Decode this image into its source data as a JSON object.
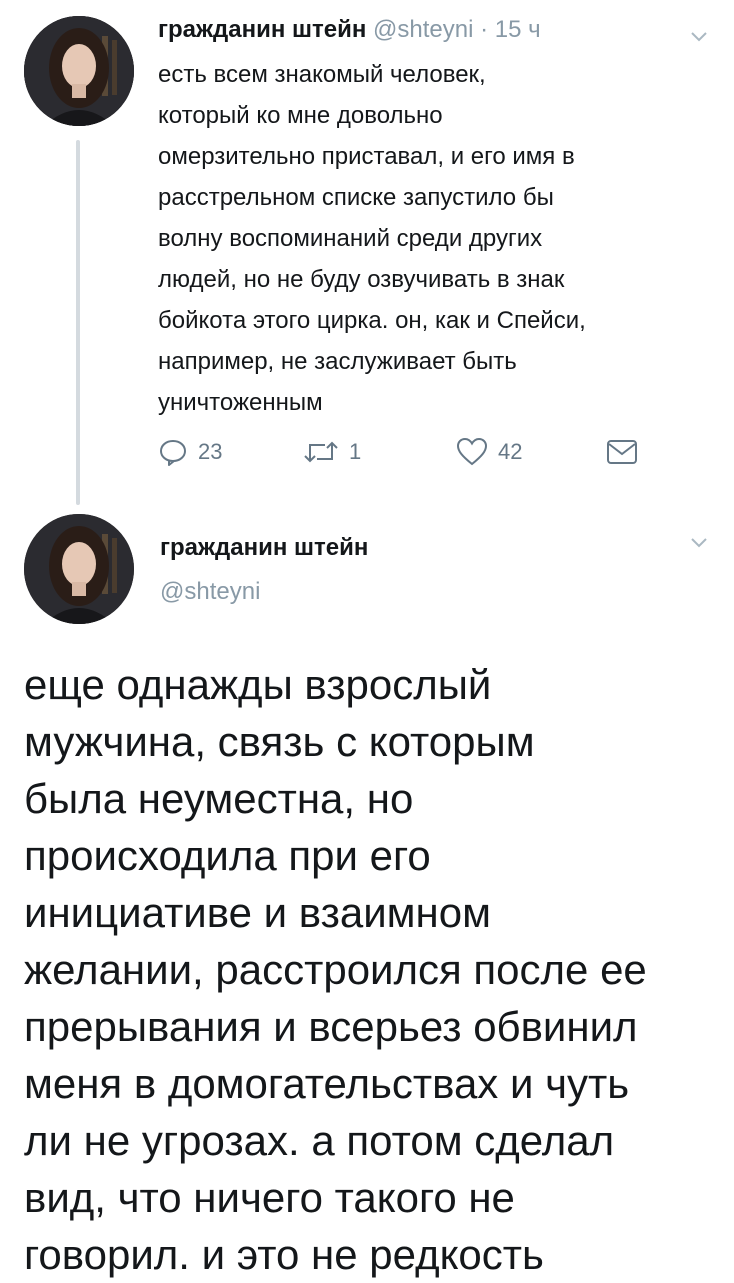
{
  "tweet1": {
    "author_name": "гражданин штейн",
    "handle": "@shteyni",
    "time": "15 ч",
    "text_lines": [
      "есть всем знакомый человек,",
      "который ко мне довольно",
      "омерзительно приставал, и его имя в",
      "расстрельном списке запустило бы",
      "волну воспоминаний среди других",
      "людей, но не буду озвучивать в знак",
      "бойкота этого цирка. он, как и Спейси,",
      "например, не заслуживает быть",
      "уничтоженным"
    ],
    "reply_count": "23",
    "retweet_count": "1",
    "like_count": "42"
  },
  "tweet2": {
    "author_name": "гражданин штейн",
    "handle": "@shteyni",
    "text_lines": [
      "еще однажды взрослый",
      "мужчина, связь с которым",
      "была неуместна, но",
      "происходила при его",
      "инициативе и взаимном",
      "желании, расстроился после ее",
      "прерывания и всерьез обвинил",
      "меня в домогательствах и чуть",
      "ли не угрозах. а потом сделал",
      "вид, что ничего такого не",
      "говорил. и это не редкость"
    ]
  },
  "icons": {
    "reply": "reply-icon",
    "retweet": "retweet-icon",
    "like": "heart-icon",
    "dm": "envelope-icon",
    "menu": "chevron-down-icon"
  },
  "colors": {
    "text": "#14171a",
    "muted": "#8899a6",
    "icon": "#657786",
    "thread_line": "#d4dadf"
  }
}
